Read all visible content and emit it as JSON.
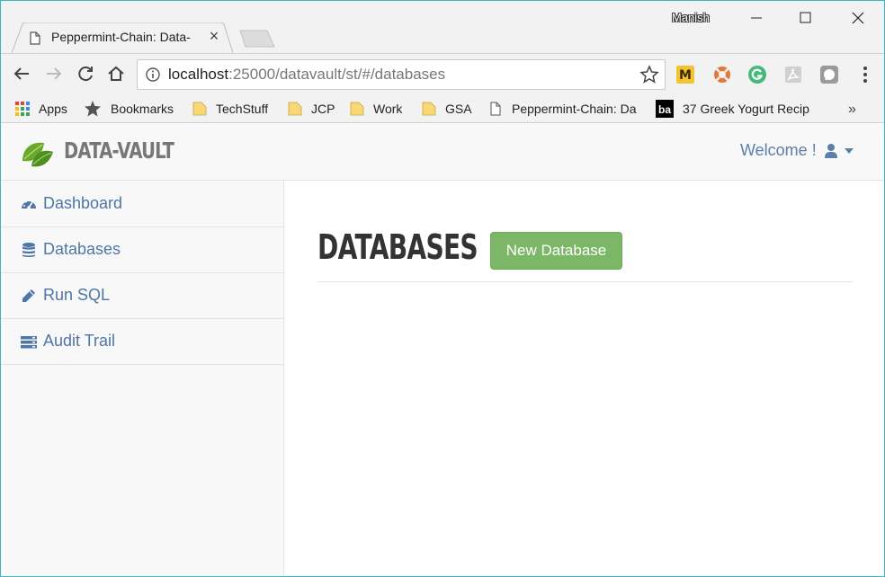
{
  "browser": {
    "tab_title": "Peppermint-Chain: Data-",
    "user_name": "Manish",
    "url_host": "localhost",
    "url_path": ":25000/datavault/st/#/databases",
    "extensions": [
      "m-extension-icon",
      "lifebuoy-extension-icon",
      "grammarly-extension-icon",
      "pdf-extension-icon",
      "chat-extension-icon"
    ],
    "bookmarks": [
      {
        "label": "Apps",
        "icon": "apps-grid-icon"
      },
      {
        "label": "Bookmarks",
        "icon": "star-icon"
      },
      {
        "label": "TechStuff",
        "icon": "folder-icon"
      },
      {
        "label": "JCP",
        "icon": "folder-icon"
      },
      {
        "label": "Work",
        "icon": "folder-icon"
      },
      {
        "label": "GSA",
        "icon": "folder-icon"
      },
      {
        "label": "Peppermint-Chain: Da",
        "icon": "page-icon"
      },
      {
        "label": "37 Greek Yogurt Recip",
        "icon": "ba-icon"
      }
    ],
    "bookmarks_more": "»"
  },
  "app": {
    "brand": "DATA-VAULT",
    "welcome": "Welcome !",
    "accent_color": "#4e76a8",
    "button_color": "#7cb767"
  },
  "sidebar": {
    "items": [
      {
        "label": "Dashboard",
        "icon": "dashboard-icon"
      },
      {
        "label": "Databases",
        "icon": "database-icon"
      },
      {
        "label": "Run SQL",
        "icon": "pencil-icon"
      },
      {
        "label": "Audit Trail",
        "icon": "audit-trail-icon"
      }
    ]
  },
  "main": {
    "title": "DATABASES",
    "new_button": "New Database"
  }
}
